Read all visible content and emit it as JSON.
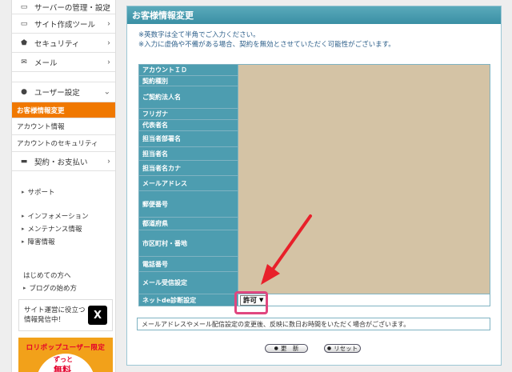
{
  "sidebar": {
    "top_item": {
      "label": "サーバーの管理・設定",
      "icon": "server-icon"
    },
    "items": [
      {
        "label": "サイト作成ツール",
        "icon": "monitor-icon"
      },
      {
        "label": "セキュリティ",
        "icon": "shield-icon"
      },
      {
        "label": "メール",
        "icon": "mail-icon"
      }
    ],
    "user_settings": {
      "label": "ユーザー設定",
      "icon": "user-icon"
    },
    "active_item": "お客様情報変更",
    "sub_items": [
      "アカウント情報",
      "アカウントのセキュリティ"
    ],
    "contract": {
      "label": "契約・お支払い",
      "icon": "card-icon"
    },
    "support": "サポート",
    "info_links": [
      "インフォメーション",
      "メンテナンス情報",
      "障害情報"
    ],
    "beginner_links": [
      "はじめての方へ",
      "ブログの始め方"
    ],
    "x_promo": {
      "line1": "サイト運営に役立つ",
      "line2": "情報発信中！",
      "logo": "X"
    },
    "banner": {
      "title": "ロリポップユーザー限定",
      "sub": "ずっと",
      "big": "無料"
    }
  },
  "panel": {
    "title": "お客様情報変更",
    "notes": [
      "※英数字は全て半角でご入力ください。",
      "※入力に虚偽や不備がある場合、契約を無効とさせていただく可能性がございます。"
    ],
    "fields": [
      {
        "label": "アカウントＩＤ"
      },
      {
        "label": "契約種別"
      },
      {
        "label": "ご契約法人名"
      },
      {
        "label": "フリガナ"
      },
      {
        "label": "代表者名"
      },
      {
        "label": "担当者部署名"
      },
      {
        "label": "担当者名"
      },
      {
        "label": "担当者名カナ"
      },
      {
        "label": "メールアドレス"
      },
      {
        "label": "郵便番号"
      },
      {
        "label": "都道府県"
      },
      {
        "label": "市区町村・番地"
      },
      {
        "label": "電話番号"
      },
      {
        "label": "メール受信設定"
      }
    ],
    "net_diagnosis": {
      "label": "ネットde診断設定",
      "selected": "許可"
    },
    "bottom_note": "メールアドレスやメール配信設定の変更後、反映に数日お時間をいただく場合がございます。",
    "buttons": {
      "update": "更　新",
      "reset": "リセット"
    }
  },
  "colors": {
    "accent": "#f07800",
    "header": "#4d9db0",
    "highlight": "#e0467f",
    "arrow": "#e8202a"
  }
}
